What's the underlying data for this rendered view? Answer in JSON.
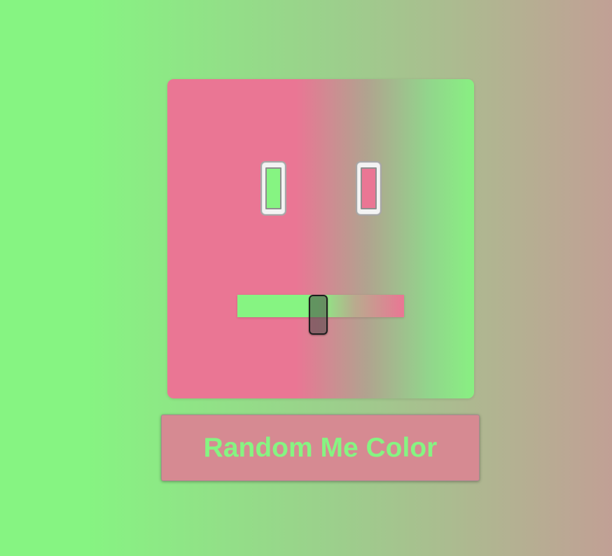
{
  "face": {
    "left_eye": {
      "pupil_color": "#86f482"
    },
    "right_eye": {
      "pupil_color": "#ea7694"
    },
    "mouth_slider": {
      "value_fraction": 0.46
    }
  },
  "colors": {
    "green": "#86f482",
    "pink": "#ea7694",
    "button_bg": "#d68a92"
  },
  "button": {
    "label": "Random Me Color"
  }
}
